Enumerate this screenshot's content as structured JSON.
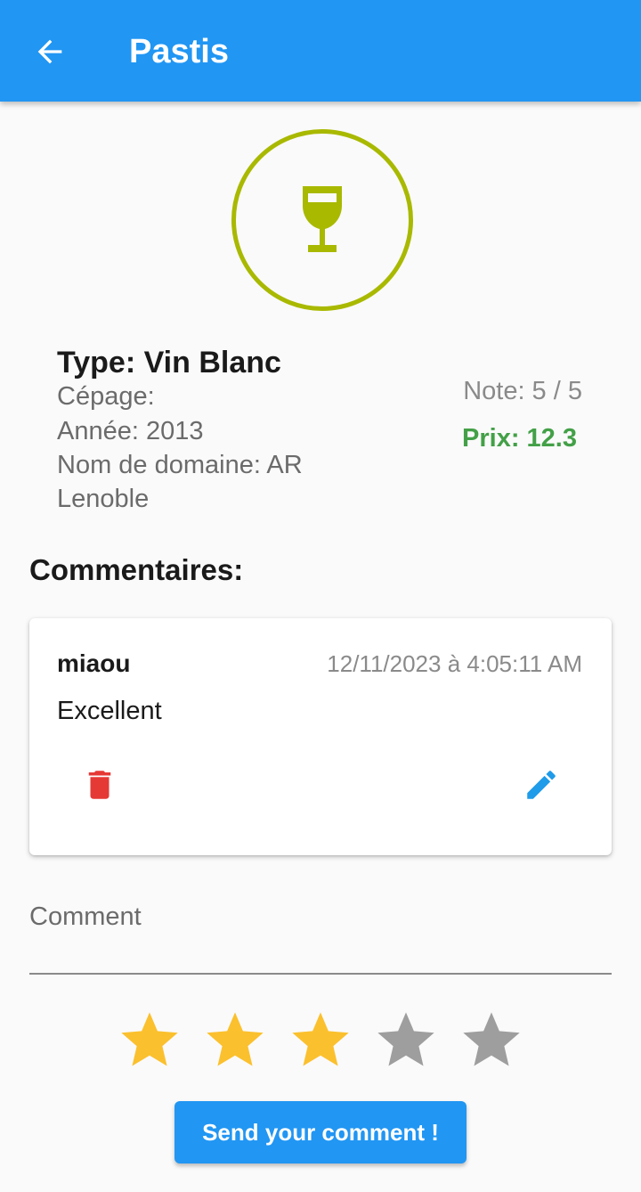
{
  "app_bar": {
    "title": "Pastis",
    "back_icon": "arrow-back-icon",
    "color": "#2196f3"
  },
  "wine": {
    "icon": "wine-glass-icon",
    "icon_color": "#a9b900",
    "type": "Type: Vin Blanc",
    "cepage": "Cépage:",
    "annee": "Année: 2013",
    "domaine_line1": "Nom de domaine: AR",
    "domaine_line2": "Lenoble",
    "note": "Note: 5 / 5",
    "prix": "Prix: 12.3",
    "prix_color": "#43a047"
  },
  "comments": {
    "title": "Commentaires:",
    "items": [
      {
        "author": "miaou",
        "date": "12/11/2023 à 4:05:11 AM",
        "text": "Excellent",
        "delete_icon": "trash-icon",
        "edit_icon": "pencil-icon"
      }
    ]
  },
  "form": {
    "comment_placeholder": "Comment",
    "comment_value": "",
    "rating": 3,
    "rating_max": 5,
    "star_active_color": "#fbc02d",
    "star_inactive_color": "#9e9e9e",
    "send_label": "Send your comment !"
  }
}
